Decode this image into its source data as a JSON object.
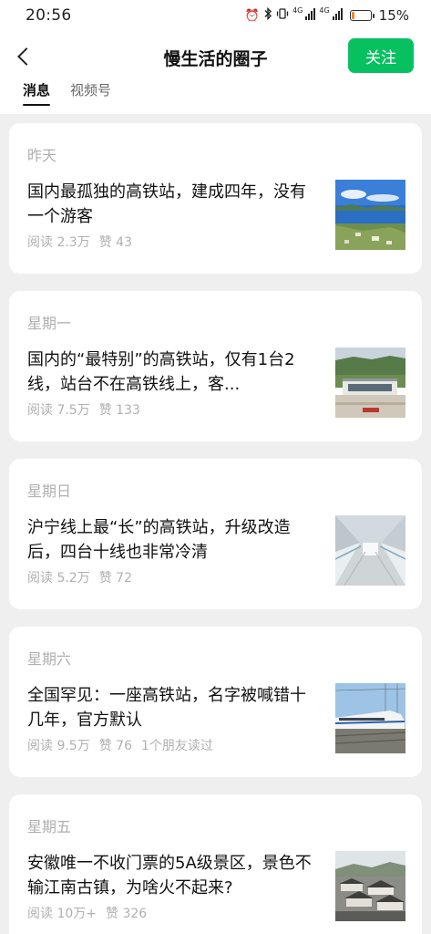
{
  "status_bar": {
    "time": "20:56",
    "battery_percent_text": "15%",
    "battery_level": 0.15,
    "icons": [
      "alarm-icon",
      "bluetooth-icon",
      "vibrate-icon",
      "signal-4g-icon",
      "signal-4g-icon",
      "battery-icon"
    ]
  },
  "header": {
    "title": "慢生活的圈子",
    "follow_label": "关注",
    "accent_color": "#07c160"
  },
  "tabs": [
    {
      "label": "消息",
      "active": true
    },
    {
      "label": "视频号",
      "active": false
    }
  ],
  "posts": [
    {
      "day": "昨天",
      "title": "国内最孤独的高铁站，建成四年，没有一个游客",
      "reads": "阅读 2.3万",
      "likes": "赞 43",
      "extra": "",
      "thumbnail": "lake-landscape"
    },
    {
      "day": "星期一",
      "title": "国内的“最特别”的高铁站，仅有1台2线，站台不在高铁线上，客...",
      "reads": "阅读 7.5万",
      "likes": "赞 133",
      "extra": "",
      "thumbnail": "station-building"
    },
    {
      "day": "星期日",
      "title": "沪宁线上最“长”的高铁站，升级改造后，四台十线也非常冷清",
      "reads": "阅读 5.2万",
      "likes": "赞 72",
      "extra": "",
      "thumbnail": "platform-corridor"
    },
    {
      "day": "星期六",
      "title": "全国罕见：一座高铁站，名字被喊错十几年，官方默认",
      "reads": "阅读 9.5万",
      "likes": "赞 76",
      "extra": "1个朋友读过",
      "thumbnail": "high-speed-train"
    },
    {
      "day": "星期五",
      "title": "安徽唯一不收门票的5A级景区，景色不输江南古镇，为啥火不起来?",
      "reads": "阅读 10万+",
      "likes": "赞 326",
      "extra": "",
      "thumbnail": "ancient-town-rooftops"
    }
  ]
}
